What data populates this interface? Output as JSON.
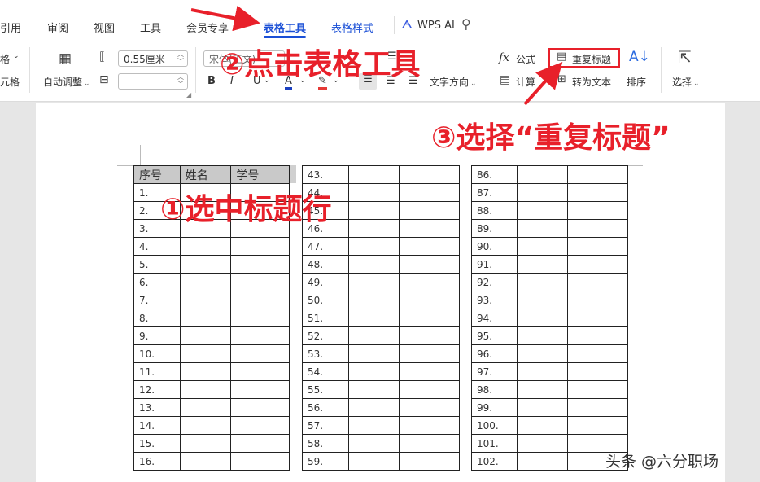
{
  "menu": {
    "items": [
      "引用",
      "审阅",
      "视图",
      "工具",
      "会员专享",
      "表格工具",
      "表格样式"
    ],
    "active": "表格工具",
    "wps_ai": "WPS AI"
  },
  "ribbon": {
    "left_cut_1": "格",
    "left_cut_2": "元格",
    "auto_adjust": "自动调整",
    "height_value": "0.55厘米",
    "width_value": "",
    "font_name": "宋体(正文)",
    "text_direction": "文字方向",
    "formula": "公式",
    "calculate": "计算",
    "repeat_title": "重复标题",
    "convert_text": "转为文本",
    "sort": "排序",
    "select": "选择"
  },
  "annotations": {
    "step1": "①选中标题行",
    "step2": "②点击表格工具",
    "step3": "③选择“重复标题”"
  },
  "table": {
    "headers": [
      "序号",
      "姓名",
      "学号"
    ],
    "col1": [
      "1.",
      "2.",
      "3.",
      "4.",
      "5.",
      "6.",
      "7.",
      "8.",
      "9.",
      "10.",
      "11.",
      "12.",
      "13.",
      "14.",
      "15.",
      "16."
    ],
    "col2": [
      "43.",
      "44.",
      "45.",
      "46.",
      "47.",
      "48.",
      "49.",
      "50.",
      "51.",
      "52.",
      "53.",
      "54.",
      "55.",
      "56.",
      "57.",
      "58.",
      "59."
    ],
    "col3": [
      "86.",
      "87.",
      "88.",
      "89.",
      "90.",
      "91.",
      "92.",
      "93.",
      "94.",
      "95.",
      "96.",
      "97.",
      "98.",
      "99.",
      "100.",
      "101.",
      "102."
    ]
  },
  "watermark": "头条 @六分职场",
  "colors": {
    "accent": "#1a4fd6",
    "annotation": "#e8202a",
    "header_fill": "#c9c9c9"
  }
}
